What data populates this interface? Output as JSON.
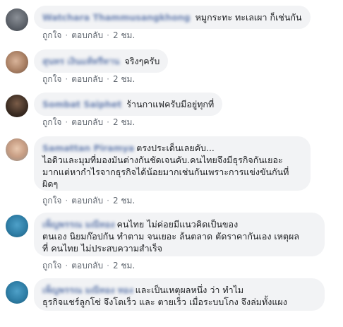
{
  "actions": {
    "like": "ถูกใจ",
    "reply": "ตอบกลับ",
    "separator": "·"
  },
  "comments": [
    {
      "name": "Watchara Thammusangkhong",
      "text": "หมูกระทะ ทะเลเผา ก็เช่นกัน",
      "time": "2 ชม."
    },
    {
      "name": "สุนทร เงินแท้ทรีทาน",
      "text": "จริงๆครับ",
      "time": "2 ชม."
    },
    {
      "name": "Sombat Saiphet",
      "text": "ร้านกาแฟครับมีอยู่ทุกที่",
      "time": "2 ชม."
    },
    {
      "name": "Samattan Piramya",
      "text": "ตรงประเด็นเลยคับ...\nไอดิวและมุมที่มองมันต่างกันชัดเจนคับ.คนไทยจึงมีธุรกิจกันเยอะ\nมากแต่หากำไรจากธุรกิจได้น้อยมากเช่นกันเพราะการแข่งขันกันที่\nผิดๆ",
      "time": "2 ชม."
    },
    {
      "name": "เพ็ญพรรณ มณีทอง",
      "text": "คนไทย ไม่ค่อยมีแนวคิดเป็นของ\nตนเอง นิยมก๊อปกัน ทำตาม จนเยอะ ล้นตลาด ตัดราคากันเอง เหตุผล\nที่ คนไทย ไม่ประสบความสำเร็จ",
      "time": "2 ชม."
    },
    {
      "name": "เพ็ญพรรณ มณีทอง ทอง",
      "text": "และเป็นเหตุผลหนึ่ง ว่า ทำไม\nธุรกิจแชร์ลูกโซ่ จึงโตเร็ว และ ตายเร็ว เมื่อระบบโกง จึงล่มทั้งแผง",
      "time": ""
    }
  ]
}
